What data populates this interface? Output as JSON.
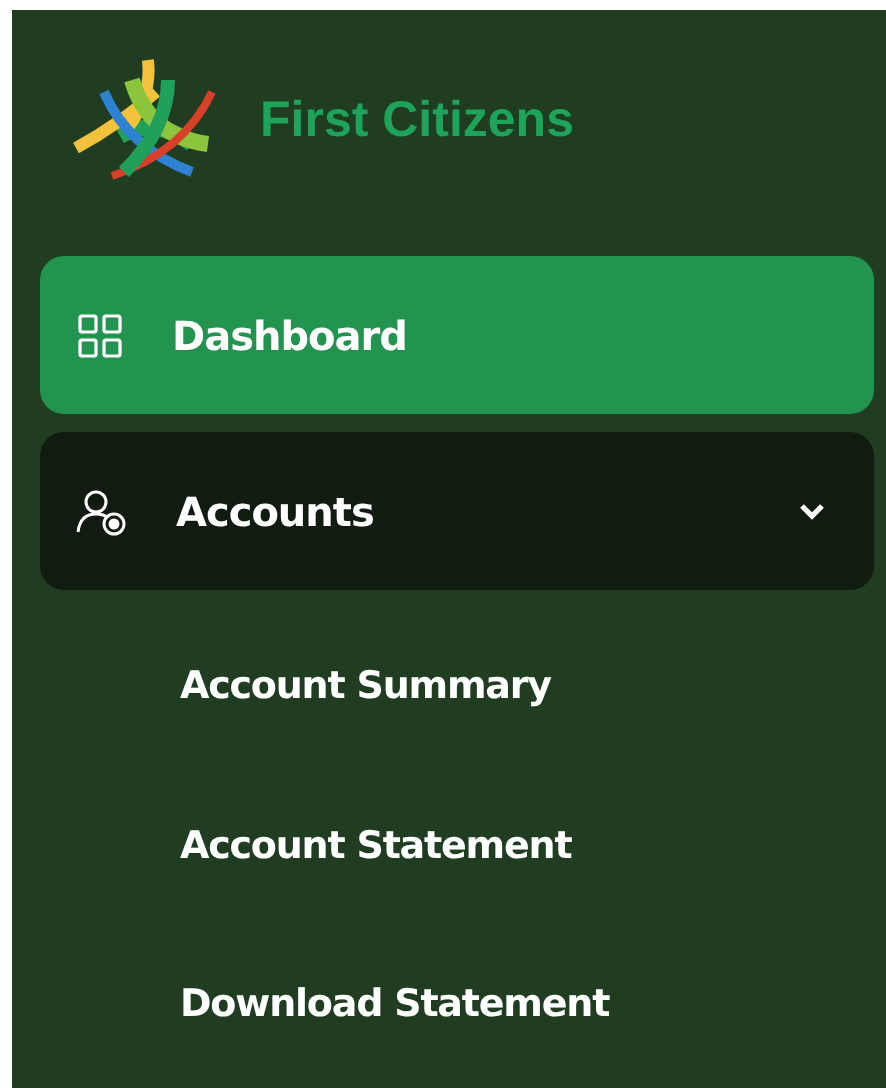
{
  "brand": {
    "name": "First Citizens"
  },
  "nav": [
    {
      "label": "Dashboard",
      "kind": "grid",
      "selected": true
    },
    {
      "label": "Accounts",
      "kind": "user",
      "selected": false,
      "expanded": true,
      "children": [
        {
          "label": "Account Summary"
        },
        {
          "label": "Account Statement"
        },
        {
          "label": "Download Statement"
        }
      ]
    }
  ]
}
